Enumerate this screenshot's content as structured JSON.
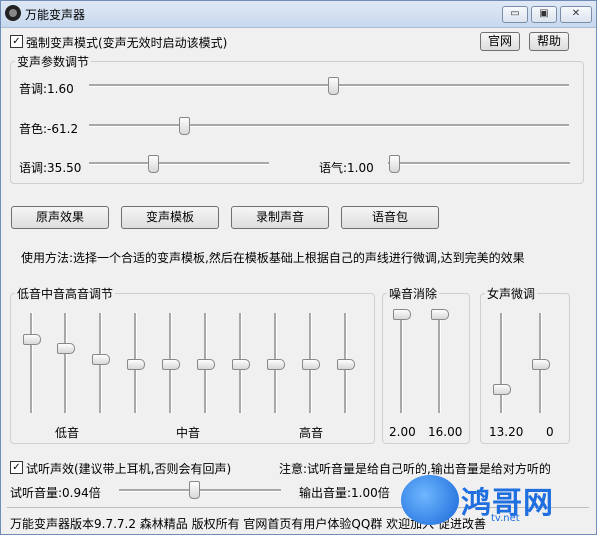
{
  "window": {
    "title": "万能变声器",
    "minimize": "▭",
    "restore": "▣",
    "close": "✕"
  },
  "top": {
    "force_mode_label": "强制变声模式(变声无效时启动该模式)",
    "force_mode_checked": true,
    "website_button": "官网",
    "help_button": "帮助"
  },
  "params": {
    "group_title": "变声参数调节",
    "pitch": {
      "label": "音调:1.60",
      "value": 1.6
    },
    "timbre": {
      "label": "音色:-61.2",
      "value": -61.2
    },
    "tempo": {
      "label": "语调:35.50",
      "value": 35.5
    },
    "tone": {
      "label": "语气:1.00",
      "value": 1.0
    }
  },
  "actions": {
    "original": "原声效果",
    "template": "变声模板",
    "record": "录制声音",
    "voice_pack": "语音包"
  },
  "usage_text": "使用方法:选择一个合适的变声模板,然后在模板基础上根据自己的声线进行微调,达到完美的效果",
  "eq": {
    "group_title": "低音中音高音调节",
    "low_label": "低音",
    "mid_label": "中音",
    "high_label": "高音",
    "bands": [
      0.75,
      0.66,
      0.55,
      0.5,
      0.5,
      0.5,
      0.5,
      0.5,
      0.5,
      0.5
    ]
  },
  "noise": {
    "group_title": "噪音消除",
    "values": [
      "2.00",
      "16.00"
    ],
    "levels": [
      1.0,
      1.0
    ]
  },
  "female": {
    "group_title": "女声微调",
    "values": [
      "13.20",
      "0"
    ],
    "levels": [
      0.25,
      0.5
    ]
  },
  "monitor": {
    "checkbox_label": "试听声效(建议带上耳机,否则会有回声)",
    "checked": true,
    "note": "注意:试听音量是给自己听的,输出音量是给对方听的",
    "monitor_volume": {
      "label": "试听音量:0.94倍",
      "value": 0.94
    },
    "output_volume": {
      "label": "输出音量:1.00倍",
      "value": 1.0
    }
  },
  "footer": {
    "text": "万能变声器版本9.7.7.2  森林精品  版权所有  官网首页有用户体验QQ群  欢迎加入  促进改善"
  },
  "watermark": {
    "text": "鸿哥网",
    "sub": "tv.net"
  },
  "colors": {
    "title_bar": "#c7d8ee",
    "window_bg": "#f0f0f0",
    "watermark": "#1f6fe0"
  }
}
